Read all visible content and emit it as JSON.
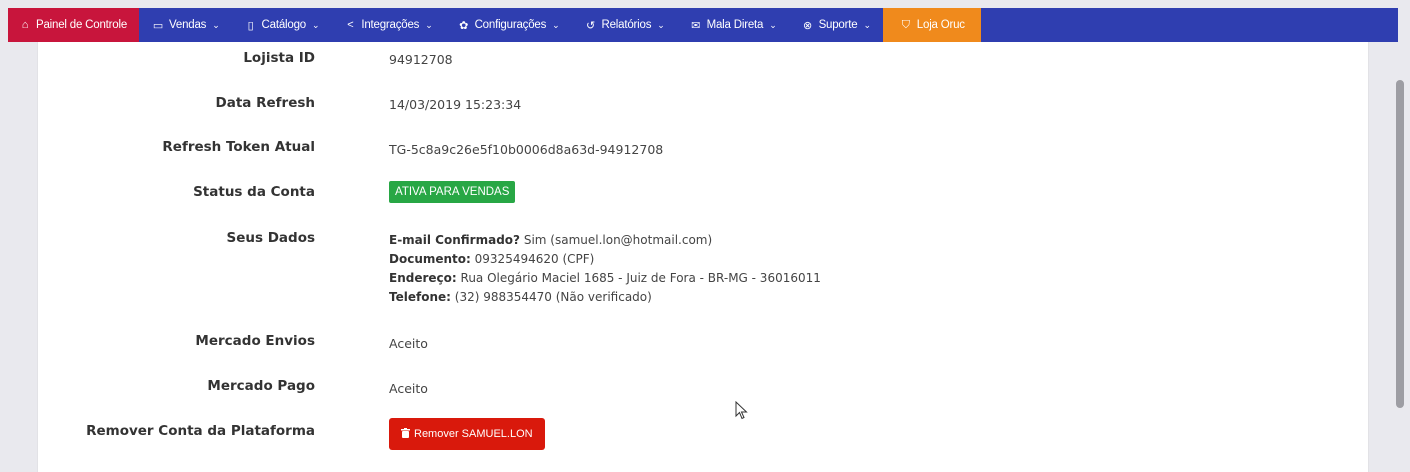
{
  "navbar": {
    "items": [
      {
        "icon": "home-icon",
        "glyph": "⌂",
        "label": "Painel de Controle"
      },
      {
        "icon": "folder-icon",
        "glyph": "▭",
        "label": "Vendas",
        "dropdown": true
      },
      {
        "icon": "book-icon",
        "glyph": "▯",
        "label": "Catálogo",
        "dropdown": true
      },
      {
        "icon": "share-icon",
        "glyph": "<",
        "label": "Integrações",
        "dropdown": true
      },
      {
        "icon": "gear-icon",
        "glyph": "✿",
        "label": "Configurações",
        "dropdown": true
      },
      {
        "icon": "history-icon",
        "glyph": "↺",
        "label": "Relatórios",
        "dropdown": true
      },
      {
        "icon": "mail-icon",
        "glyph": "✉",
        "label": "Mala Direta",
        "dropdown": true
      },
      {
        "icon": "support-icon",
        "glyph": "⊗",
        "label": "Suporte",
        "dropdown": true
      },
      {
        "icon": "cart-icon",
        "glyph": "⛉",
        "label": "Loja Oruc"
      }
    ],
    "chevron": "⌄",
    "colors": {
      "bar": "#2f3eb0",
      "active": "#c8153c",
      "store": "#f08a1c"
    }
  },
  "account": {
    "lojista_id": {
      "label": "Lojista ID",
      "value": "94912708"
    },
    "data_refresh": {
      "label": "Data Refresh",
      "value": "14/03/2019 15:23:34"
    },
    "refresh_token": {
      "label": "Refresh Token Atual",
      "value": "TG-5c8a9c26e5f10b0006d8a63d-94912708"
    },
    "status": {
      "label": "Status da Conta",
      "value": "ATIVA PARA VENDAS",
      "color": "#28a745"
    },
    "seus_dados": {
      "label": "Seus Dados",
      "email_label": "E-mail Confirmado?",
      "email_value": "Sim (samuel.lon@hotmail.com)",
      "documento_label": "Documento:",
      "documento_value": "09325494620 (CPF)",
      "endereco_label": "Endereço:",
      "endereco_value": "Rua Olegário Maciel 1685 - Juiz de Fora - BR-MG - 36016011",
      "telefone_label": "Telefone:",
      "telefone_value": "(32) 988354470 (Não verificado)"
    },
    "mercado_envios": {
      "label": "Mercado Envios",
      "value": "Aceito"
    },
    "mercado_pago": {
      "label": "Mercado Pago",
      "value": "Aceito"
    },
    "remover": {
      "label": "Remover Conta da Plataforma",
      "button": "Remover SAMUEL.LON",
      "button_icon": "trash-icon",
      "color": "#d9190c"
    }
  }
}
